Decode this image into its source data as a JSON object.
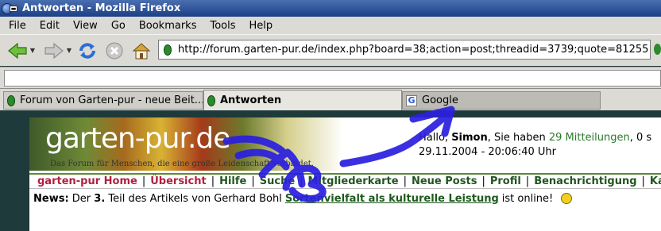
{
  "window": {
    "title": "Antworten - Mozilla Firefox"
  },
  "menu": [
    "File",
    "Edit",
    "View",
    "Go",
    "Bookmarks",
    "Tools",
    "Help"
  ],
  "toolbar": {
    "back_icon": "back-arrow-icon",
    "forward_icon": "forward-arrow-icon",
    "reload_icon": "reload-icon",
    "stop_icon": "stop-icon",
    "home_icon": "home-icon"
  },
  "address": {
    "url": "http://forum.garten-pur.de/index.php?board=38;action=post;threadid=3739;quote=81255"
  },
  "tabs": [
    {
      "label": "Forum von Garten-pur - neue Beit...",
      "active": false
    },
    {
      "label": "Antworten",
      "active": true
    },
    {
      "label": "Google",
      "active": false
    }
  ],
  "page": {
    "logo": "garten-pur.de",
    "slogan": "Das Forum für Menschen, die eine große Leidenschaft verbindet.",
    "greeting_prefix": "Hallo, ",
    "user": "Simon",
    "greeting_mid": ", Sie haben ",
    "messages": "29 Mitteilungen",
    "greeting_suffix": ", 0 s",
    "datetime": "29.11.2004 - 20:06:40 Uhr",
    "nav": [
      "garten-pur Home",
      "Übersicht",
      "Hilfe",
      "Suche",
      "Mitgliederkarte",
      "Neue Posts",
      "Profil",
      "Benachrichtigung",
      "Kale"
    ],
    "news_label": "News:",
    "news_text_1": "Der",
    "news_num": "3.",
    "news_text_2": "Teil des Artikels von Gerhard Bohl",
    "news_link": "Sortenvielfalt als kulturelle Leistung",
    "news_text_3": "ist online!"
  },
  "colors": {
    "title_bar": "#1b3f86",
    "chrome": "#dcdad5",
    "annotation_ink": "#2a1fe0",
    "forum_green": "#2b7a2b"
  }
}
